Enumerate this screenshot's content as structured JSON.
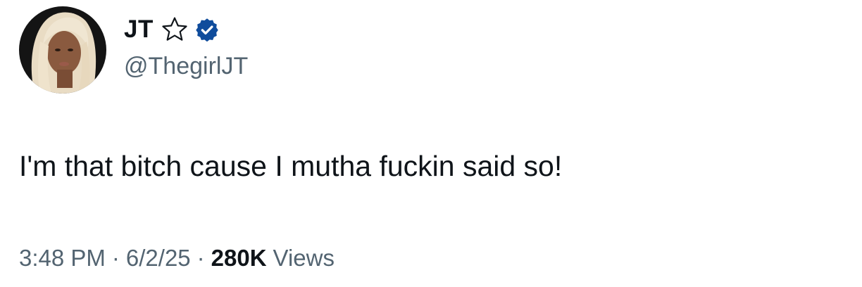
{
  "author": {
    "display_name": "JT",
    "handle": "@ThegirlJT",
    "avatar_icon": "profile-photo",
    "badges": [
      "star-outline-icon",
      "verified-badge-icon"
    ],
    "verified_color": "#0f4c9c"
  },
  "tweet": {
    "text": "I'm that bitch cause I mutha fuckin said so!"
  },
  "meta": {
    "time": "3:48 PM",
    "separator": "·",
    "date": "6/2/25",
    "views_count": "280K",
    "views_label": "Views"
  },
  "colors": {
    "text_primary": "#0f1419",
    "text_secondary": "#536471",
    "background": "#ffffff"
  }
}
